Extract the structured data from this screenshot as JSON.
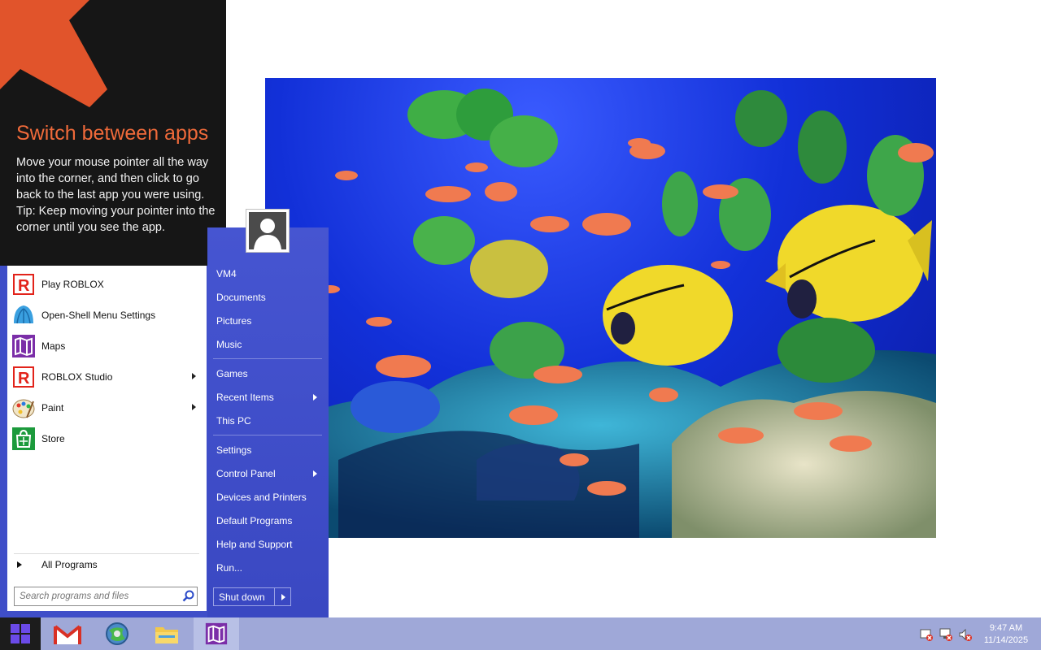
{
  "tip": {
    "title": "Switch between apps",
    "body": "Move your mouse pointer all the way into the corner, and then click to go back to the last app you were using.",
    "tip_text": "Tip: Keep moving your pointer into the corner until you see the app.",
    "accent_color": "#f06a3a"
  },
  "start_menu": {
    "programs": [
      {
        "label": "Play ROBLOX",
        "icon": "roblox-icon",
        "has_submenu": false
      },
      {
        "label": "Open-Shell Menu Settings",
        "icon": "shell-icon",
        "has_submenu": false
      },
      {
        "label": "Maps",
        "icon": "maps-icon",
        "has_submenu": false
      },
      {
        "label": "ROBLOX Studio",
        "icon": "roblox-studio-icon",
        "has_submenu": true
      },
      {
        "label": "Paint",
        "icon": "paint-icon",
        "has_submenu": true
      },
      {
        "label": "Store",
        "icon": "store-icon",
        "has_submenu": false
      }
    ],
    "all_programs_label": "All Programs",
    "search_placeholder": "Search programs and files",
    "right_items": [
      {
        "label": "VM4",
        "has_submenu": false
      },
      {
        "label": "Documents",
        "has_submenu": false
      },
      {
        "label": "Pictures",
        "has_submenu": false
      },
      {
        "label": "Music",
        "has_submenu": false
      },
      {
        "label": "Games",
        "has_submenu": false
      },
      {
        "label": "Recent Items",
        "has_submenu": true
      },
      {
        "label": "This PC",
        "has_submenu": false
      },
      {
        "label": "Settings",
        "has_submenu": false
      },
      {
        "label": "Control Panel",
        "has_submenu": true
      },
      {
        "label": "Devices and Printers",
        "has_submenu": false
      },
      {
        "label": "Default Programs",
        "has_submenu": false
      },
      {
        "label": "Help and Support",
        "has_submenu": false
      },
      {
        "label": "Run...",
        "has_submenu": false
      }
    ],
    "shutdown_label": "Shut down",
    "pane_color": "#3f4ec8"
  },
  "taskbar": {
    "apps": [
      {
        "name": "gmail-icon"
      },
      {
        "name": "browser-icon"
      },
      {
        "name": "file-explorer-icon"
      },
      {
        "name": "maps-icon",
        "active": true
      }
    ],
    "tray": [
      "action-center-icon",
      "network-icon",
      "volume-muted-icon"
    ],
    "time": "9:47 AM",
    "date": "11/14/2025",
    "color": "#9fa8d8"
  }
}
